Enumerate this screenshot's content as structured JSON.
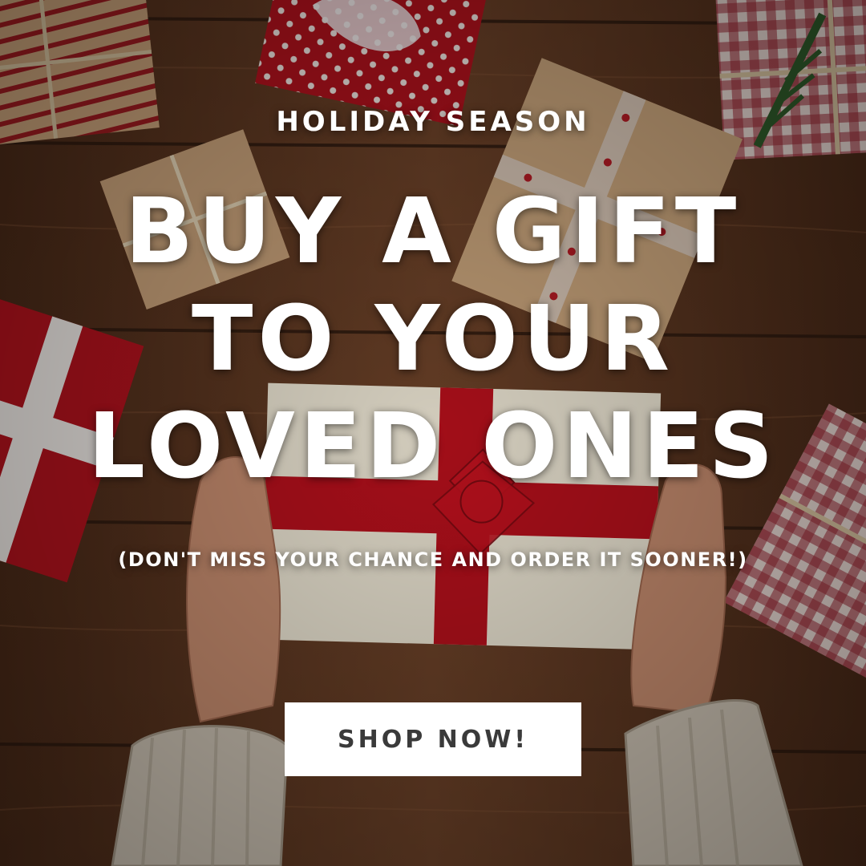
{
  "banner": {
    "eyebrow": "HOLIDAY SEASON",
    "headline_lines": [
      "BUY A GIFT",
      "TO YOUR",
      "LOVED ONES"
    ],
    "subtext": "(DON'T MISS YOUR CHANCE AND ORDER IT SOONER!)",
    "cta_label": "SHOP NOW!"
  },
  "colors": {
    "wood": "#6b4128",
    "wrap_red": "#b3121d",
    "ribbon_red": "#c4121f",
    "kraft": "#c9a27a",
    "cream_paper": "#efe8d6",
    "text": "#ffffff",
    "button_bg": "#ffffff",
    "button_text": "#3a3a3a"
  }
}
